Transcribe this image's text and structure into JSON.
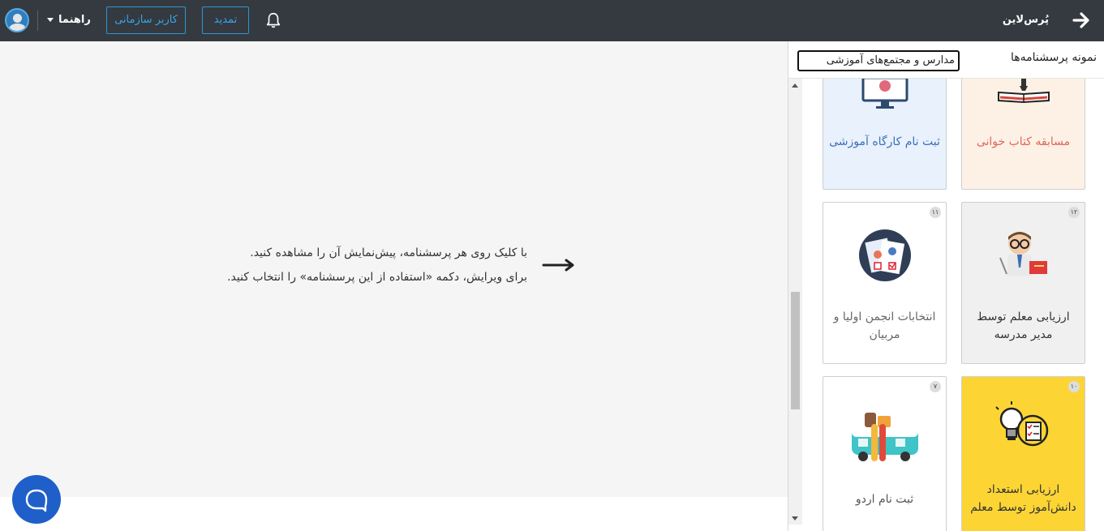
{
  "header": {
    "brand": "پُرس‌لاین",
    "help_label": "راهنما",
    "org_user_label": "کاربر سازمانی",
    "renew_label": "تمدید",
    "icons": {
      "back": "arrow-right-icon",
      "bell": "bell-icon",
      "avatar": "user-avatar-icon",
      "caret": "caret-down-icon"
    }
  },
  "main": {
    "hint_line1": "با کلیک روی هر پرسشنامه، پیش‌نمایش آن را مشاهده کنید.",
    "hint_line2": "برای ویرایش، دکمه «استفاده از این پرسشنامه» را انتخاب کنید.",
    "chat_icon": "chat-bubble-icon"
  },
  "side": {
    "title": "نمونه پرسشنامه‌ها",
    "category_selected": "مدارس و مجتمع‌های آموزشی",
    "cards": [
      {
        "label": "مسابقه کتاب خوانی",
        "icon": "book-reading-icon",
        "bg": "#fdf1e6",
        "color": "#e0655a"
      },
      {
        "label": "ثبت نام کارگاه آموزشی",
        "icon": "monitor-presentation-icon",
        "bg": "#e8f1fc",
        "color": "#3a6fb7"
      },
      {
        "number": "۱۲",
        "label": "ارزیابی معلم توسط مدیر مدرسه",
        "icon": "teacher-icon",
        "bg": "#f0f0f0",
        "color": "#333"
      },
      {
        "number": "۱۱",
        "label": "انتخابات انجمن اولیا و مربیان",
        "icon": "election-ballot-icon",
        "bg": "#ffffff",
        "color": "#666"
      },
      {
        "number": "۱۰",
        "label": "ارزیابی استعداد دانش‌آموز توسط معلم",
        "icon": "lightbulb-talent-icon",
        "bg": "#fcd535",
        "color": "#333"
      },
      {
        "number": "۷",
        "label": "ثبت نام اردو",
        "icon": "camping-van-icon",
        "bg": "#ffffff",
        "color": "#555"
      }
    ]
  }
}
